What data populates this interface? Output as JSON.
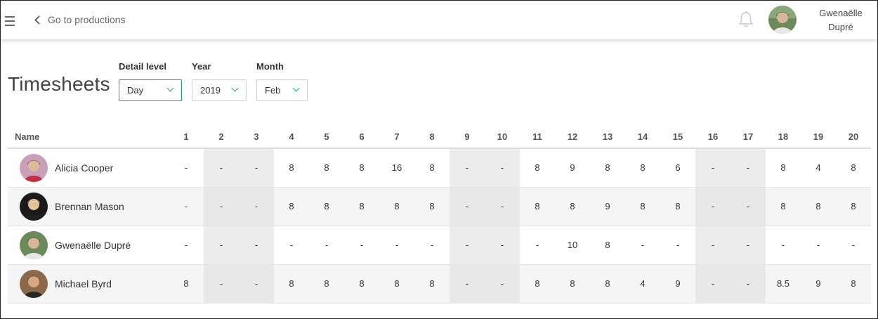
{
  "header": {
    "back_label": "Go to productions",
    "user_name_line1": "Gwenaëlle",
    "user_name_line2": "Dupré"
  },
  "page": {
    "title": "Timesheets"
  },
  "filters": {
    "detail_level": {
      "label": "Detail level",
      "value": "Day"
    },
    "year": {
      "label": "Year",
      "value": "2019"
    },
    "month": {
      "label": "Month",
      "value": "Feb"
    }
  },
  "table": {
    "name_header": "Name",
    "days": [
      "1",
      "2",
      "3",
      "4",
      "5",
      "6",
      "7",
      "8",
      "9",
      "10",
      "11",
      "12",
      "13",
      "14",
      "15",
      "16",
      "17",
      "18",
      "19",
      "20"
    ],
    "weekend_days": [
      "2",
      "3",
      "9",
      "10",
      "16",
      "17"
    ],
    "rows": [
      {
        "name": "Alicia Cooper",
        "values": [
          "-",
          "-",
          "-",
          "8",
          "8",
          "8",
          "16",
          "8",
          "-",
          "-",
          "8",
          "9",
          "8",
          "8",
          "6",
          "-",
          "-",
          "8",
          "4",
          "8"
        ]
      },
      {
        "name": "Brennan Mason",
        "values": [
          "-",
          "-",
          "-",
          "8",
          "8",
          "8",
          "8",
          "8",
          "-",
          "-",
          "8",
          "8",
          "9",
          "8",
          "8",
          "-",
          "-",
          "8",
          "8",
          "8"
        ]
      },
      {
        "name": "Gwenaëlle Dupré",
        "values": [
          "-",
          "-",
          "-",
          "-",
          "-",
          "-",
          "-",
          "-",
          "-",
          "-",
          "-",
          "10",
          "8",
          "-",
          "-",
          "-",
          "-",
          "-",
          "-",
          "-"
        ]
      },
      {
        "name": "Michael Byrd",
        "values": [
          "8",
          "-",
          "-",
          "8",
          "8",
          "8",
          "8",
          "8",
          "-",
          "-",
          "8",
          "8",
          "8",
          "4",
          "9",
          "-",
          "-",
          "8.5",
          "9",
          "8"
        ]
      }
    ]
  },
  "colors": {
    "accent": "#1aa57f",
    "weekend": "#ececec",
    "alt_row": "#f5f5f5"
  }
}
